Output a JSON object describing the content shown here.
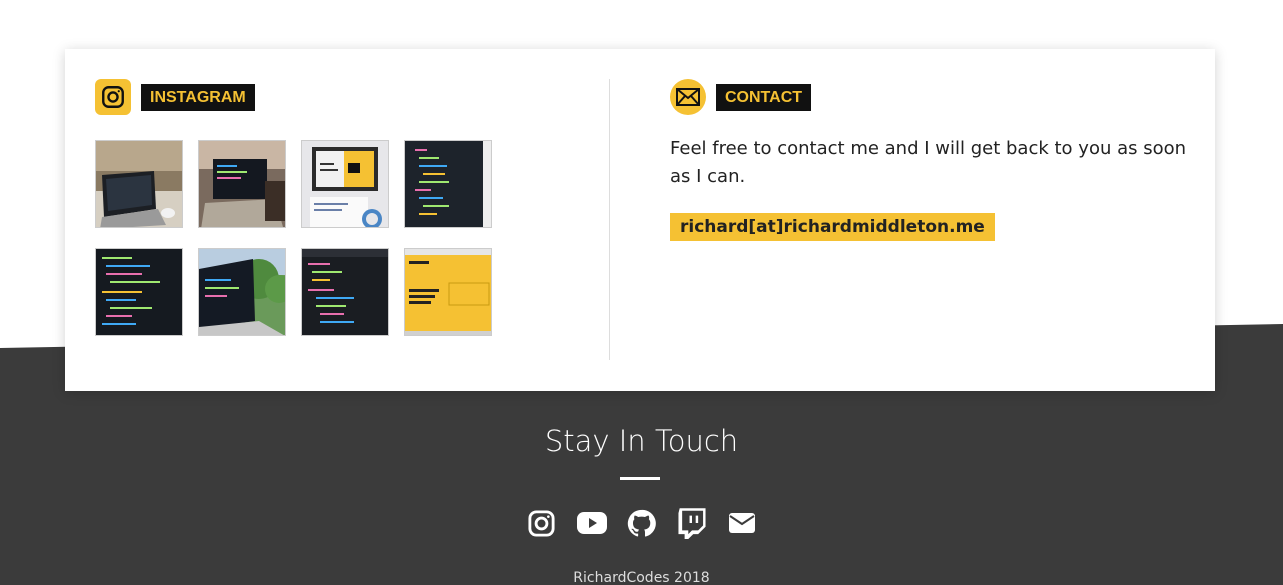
{
  "instagram": {
    "title": "INSTAGRAM",
    "icon": "instagram-icon",
    "thumbnails": [
      {
        "name": "laptop-cafe-photo"
      },
      {
        "name": "laptop-people-photo"
      },
      {
        "name": "laptop-notebook-photo"
      },
      {
        "name": "code-screen-photo"
      },
      {
        "name": "code-editor-photo"
      },
      {
        "name": "laptop-balcony-photo"
      },
      {
        "name": "code-monitor-photo"
      },
      {
        "name": "yellow-website-photo"
      }
    ]
  },
  "contact": {
    "title": "CONTACT",
    "icon": "envelope-icon",
    "text": "Feel free to contact me and I will get back to you as soon as I can.",
    "email": "richard[at]richardmiddleton.me"
  },
  "footer": {
    "title": "Stay In Touch",
    "social": [
      "instagram-icon",
      "youtube-icon",
      "github-icon",
      "twitch-icon",
      "envelope-icon"
    ],
    "copyright": "RichardCodes 2018"
  },
  "colors": {
    "accent": "#f5c133",
    "dark": "#111111",
    "footer_bg": "#3b3b3b"
  }
}
